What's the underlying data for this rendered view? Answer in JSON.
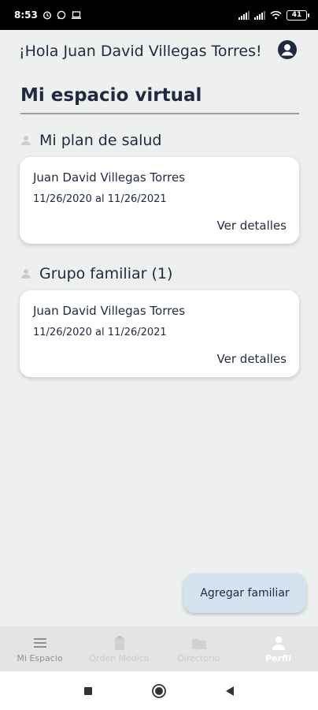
{
  "status_bar": {
    "time": "8:53",
    "battery": "41",
    "icons": [
      "alarm-icon",
      "whatsapp-icon",
      "laptop-icon",
      "signal-icon",
      "wifi-icon",
      "battery-icon"
    ]
  },
  "header": {
    "greeting": "¡Hola Juan David Villegas Torres!",
    "profile_icon": "account-circle-icon"
  },
  "main": {
    "title": "Mi espacio virtual",
    "sections": [
      {
        "title": "Mi plan de salud",
        "icon": "person-icon",
        "card": {
          "name": "Juan David Villegas Torres",
          "dates": "11/26/2020 al 11/26/2021",
          "link": "Ver detalles"
        }
      },
      {
        "title": "Grupo familiar (1)",
        "icon": "person-icon",
        "card": {
          "name": "Juan David Villegas Torres",
          "dates": "11/26/2020 al 11/26/2021",
          "link": "Ver detalles"
        }
      }
    ],
    "fab_label": "Agregar familiar"
  },
  "bottom_nav": {
    "items": [
      {
        "label": "Mi Espacio",
        "icon": "menu-icon"
      },
      {
        "label": "Orden Médica",
        "icon": "clipboard-icon"
      },
      {
        "label": "Directorio",
        "icon": "folder-icon"
      },
      {
        "label": "Perfil",
        "icon": "person-icon"
      }
    ],
    "active": "Perfil"
  },
  "system_nav": {
    "icons": [
      "recents-square-icon",
      "home-circle-icon",
      "back-triangle-icon"
    ]
  },
  "colors": {
    "background": "#eef0ef",
    "text": "#1f2a40",
    "card": "#ffffff",
    "fab": "#d4e2ef",
    "nav_bar": "#e3e5e4",
    "nav_active": "#ffffff"
  }
}
